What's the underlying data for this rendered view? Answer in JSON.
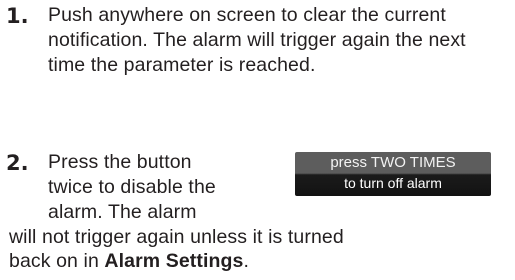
{
  "steps": [
    {
      "number": "1.",
      "text": "Push anywhere on screen to clear the current notification. The alarm will trigger again the next time the parameter is reached."
    },
    {
      "number": "2.",
      "lines": [
        "Press the button",
        "twice to disable the",
        "alarm. The alarm",
        "will not trigger again unless it is turned",
        "back on in "
      ],
      "bold_text": "Alarm Settings",
      "end_punct": "."
    }
  ],
  "alarm_button": {
    "line1": "press TWO TIMES",
    "line2": "to turn off alarm"
  }
}
